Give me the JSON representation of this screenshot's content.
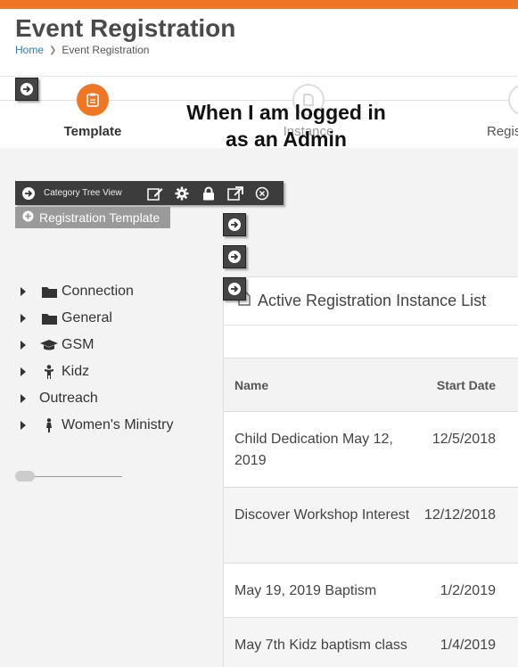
{
  "header": {
    "title": "Event Registration",
    "breadcrumb": {
      "home": "Home",
      "current": "Event Registration"
    }
  },
  "steps": [
    {
      "label": "Template",
      "state": "active"
    },
    {
      "label": "Instance",
      "state": "inactive"
    },
    {
      "label": "Regis",
      "state": "inactive"
    }
  ],
  "overlay_note": {
    "line1": "When I am logged in",
    "line2": "as an Admin"
  },
  "admin_toolbar": {
    "label": "Category Tree View",
    "icons": [
      "arrow-circle-right-icon",
      "edit-icon",
      "gear-icon",
      "lock-icon",
      "external-link-icon",
      "close-circle-icon"
    ]
  },
  "add_template_button": {
    "label": "Registration Template"
  },
  "tree": [
    {
      "label": "Connection",
      "icon": "folder-icon",
      "has_children": true
    },
    {
      "label": "General",
      "icon": "folder-icon",
      "has_children": true
    },
    {
      "label": "GSM",
      "icon": "graduation-cap-icon",
      "has_children": true
    },
    {
      "label": "Kidz",
      "icon": "child-icon",
      "has_children": true
    },
    {
      "label": "Outreach",
      "icon": "",
      "has_children": true
    },
    {
      "label": "Women's Ministry",
      "icon": "female-icon",
      "has_children": true
    }
  ],
  "instance_list": {
    "title": "Active Registration Instance List",
    "columns": [
      "Name",
      "Start Date"
    ],
    "rows": [
      {
        "name": "Child Dedication May 12, 2019",
        "start_date": "12/5/2018"
      },
      {
        "name": "Discover Workshop Interest",
        "start_date": "12/12/2018"
      },
      {
        "name": "May 19, 2019 Baptism",
        "start_date": "1/2/2019"
      },
      {
        "name": "May 7th Kidz baptism class",
        "start_date": "1/4/2019"
      }
    ]
  },
  "colors": {
    "accent": "#ee7624",
    "link": "#2a7fc1",
    "toolbar": "#3c3c3c"
  }
}
